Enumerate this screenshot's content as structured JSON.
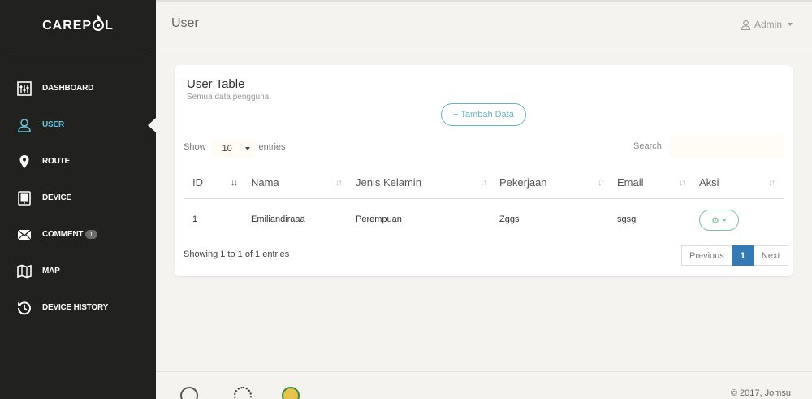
{
  "brand": {
    "name_left": "CAREP",
    "name_right": "L"
  },
  "sidebar": {
    "items": [
      {
        "label": "DASHBOARD",
        "icon": "dashboard-icon"
      },
      {
        "label": "USER",
        "icon": "user-icon",
        "active": true
      },
      {
        "label": "ROUTE",
        "icon": "map-pin-icon"
      },
      {
        "label": "DEVICE",
        "icon": "tablet-icon"
      },
      {
        "label": "COMMENT",
        "icon": "envelope-icon",
        "badge": "1"
      },
      {
        "label": "MAP",
        "icon": "map-icon"
      },
      {
        "label": "DEVICE HISTORY",
        "icon": "history-icon"
      }
    ]
  },
  "header": {
    "title": "User",
    "user_menu": "Admin"
  },
  "card": {
    "title": "User Table",
    "subtitle": "Semua data pengguna",
    "add_button": "+ Tambah Data",
    "show_label": "Show",
    "entries_value": "10",
    "entries_label": "entries",
    "search_label": "Search:",
    "search_value": ""
  },
  "table": {
    "columns": [
      "ID",
      "Nama",
      "Jenis Kelamin",
      "Pekerjaan",
      "Email",
      "Aksi"
    ],
    "rows": [
      {
        "id": "1",
        "nama": "Emiliandiraaa",
        "jenis_kelamin": "Perempuan",
        "pekerjaan": "Zggs",
        "email": "sgsg"
      }
    ],
    "info": "Showing 1 to 1 of 1 entries",
    "pagination": {
      "previous": "Previous",
      "current": "1",
      "next": "Next"
    }
  },
  "footer": {
    "copyright": "© 2017, Jomsu"
  },
  "colors": {
    "sidebar_bg": "#212120",
    "active": "#66c2d8",
    "primary": "#337ab7",
    "info": "#68b3c8",
    "success": "#7ac29a"
  }
}
